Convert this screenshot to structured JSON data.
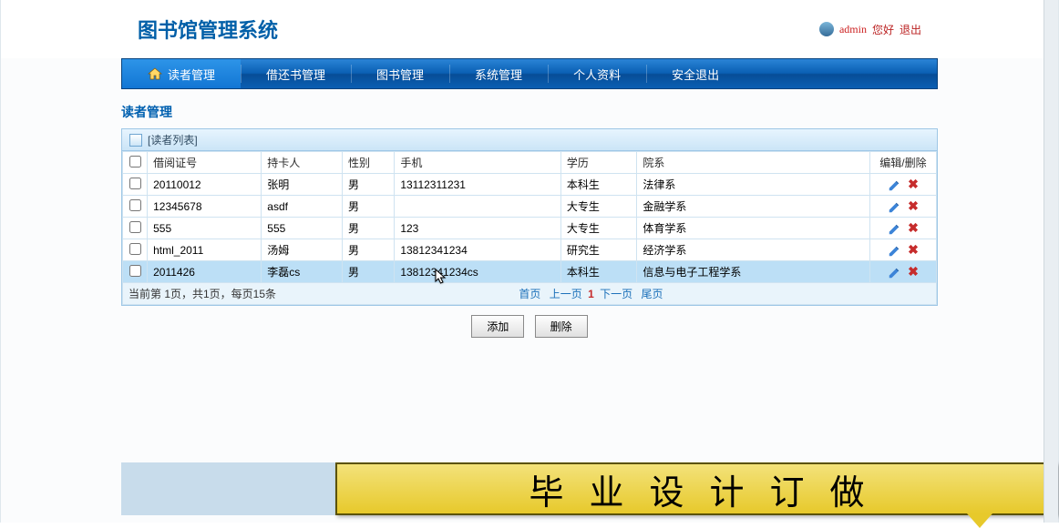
{
  "header": {
    "logo_text": "图书馆管理系统",
    "admin_user": "admin",
    "greeting": "您好",
    "logout": "退出"
  },
  "nav": {
    "items": [
      {
        "label": "读者管理",
        "active": true,
        "icon": "home"
      },
      {
        "label": "借还书管理"
      },
      {
        "label": "图书管理"
      },
      {
        "label": "系统管理"
      },
      {
        "label": "个人资料"
      },
      {
        "label": "安全退出"
      }
    ]
  },
  "section": {
    "title": "读者管理",
    "panel_title": "[读者列表]"
  },
  "table": {
    "headers": [
      "借阅证号",
      "持卡人",
      "性别",
      "手机",
      "学历",
      "院系",
      "编辑/删除"
    ],
    "rows": [
      {
        "card": "20110012",
        "holder": "张明",
        "gender": "男",
        "phone": "13112311231",
        "edu": "本科生",
        "dept": "法律系",
        "selected": false
      },
      {
        "card": "12345678",
        "holder": "asdf",
        "gender": "男",
        "phone": "",
        "edu": "大专生",
        "dept": "金融学系",
        "selected": false
      },
      {
        "card": "555",
        "holder": "555",
        "gender": "男",
        "phone": "123",
        "edu": "大专生",
        "dept": "体育学系",
        "selected": false
      },
      {
        "card": "html_2011",
        "holder": "汤姆",
        "gender": "男",
        "phone": "13812341234",
        "edu": "研究生",
        "dept": "经济学系",
        "selected": false
      },
      {
        "card": "2011426",
        "holder": "李磊cs",
        "gender": "男",
        "phone": "13812341234cs",
        "edu": "本科生",
        "dept": "信息与电子工程学系",
        "selected": true
      }
    ]
  },
  "pager": {
    "info": "当前第 1页，共1页，每页15条",
    "first": "首页",
    "prev": "上一页",
    "current": "1",
    "next": "下一页",
    "last": "尾页"
  },
  "buttons": {
    "add": "添加",
    "del": "删除"
  },
  "banner": {
    "text": "毕业设计订做"
  }
}
